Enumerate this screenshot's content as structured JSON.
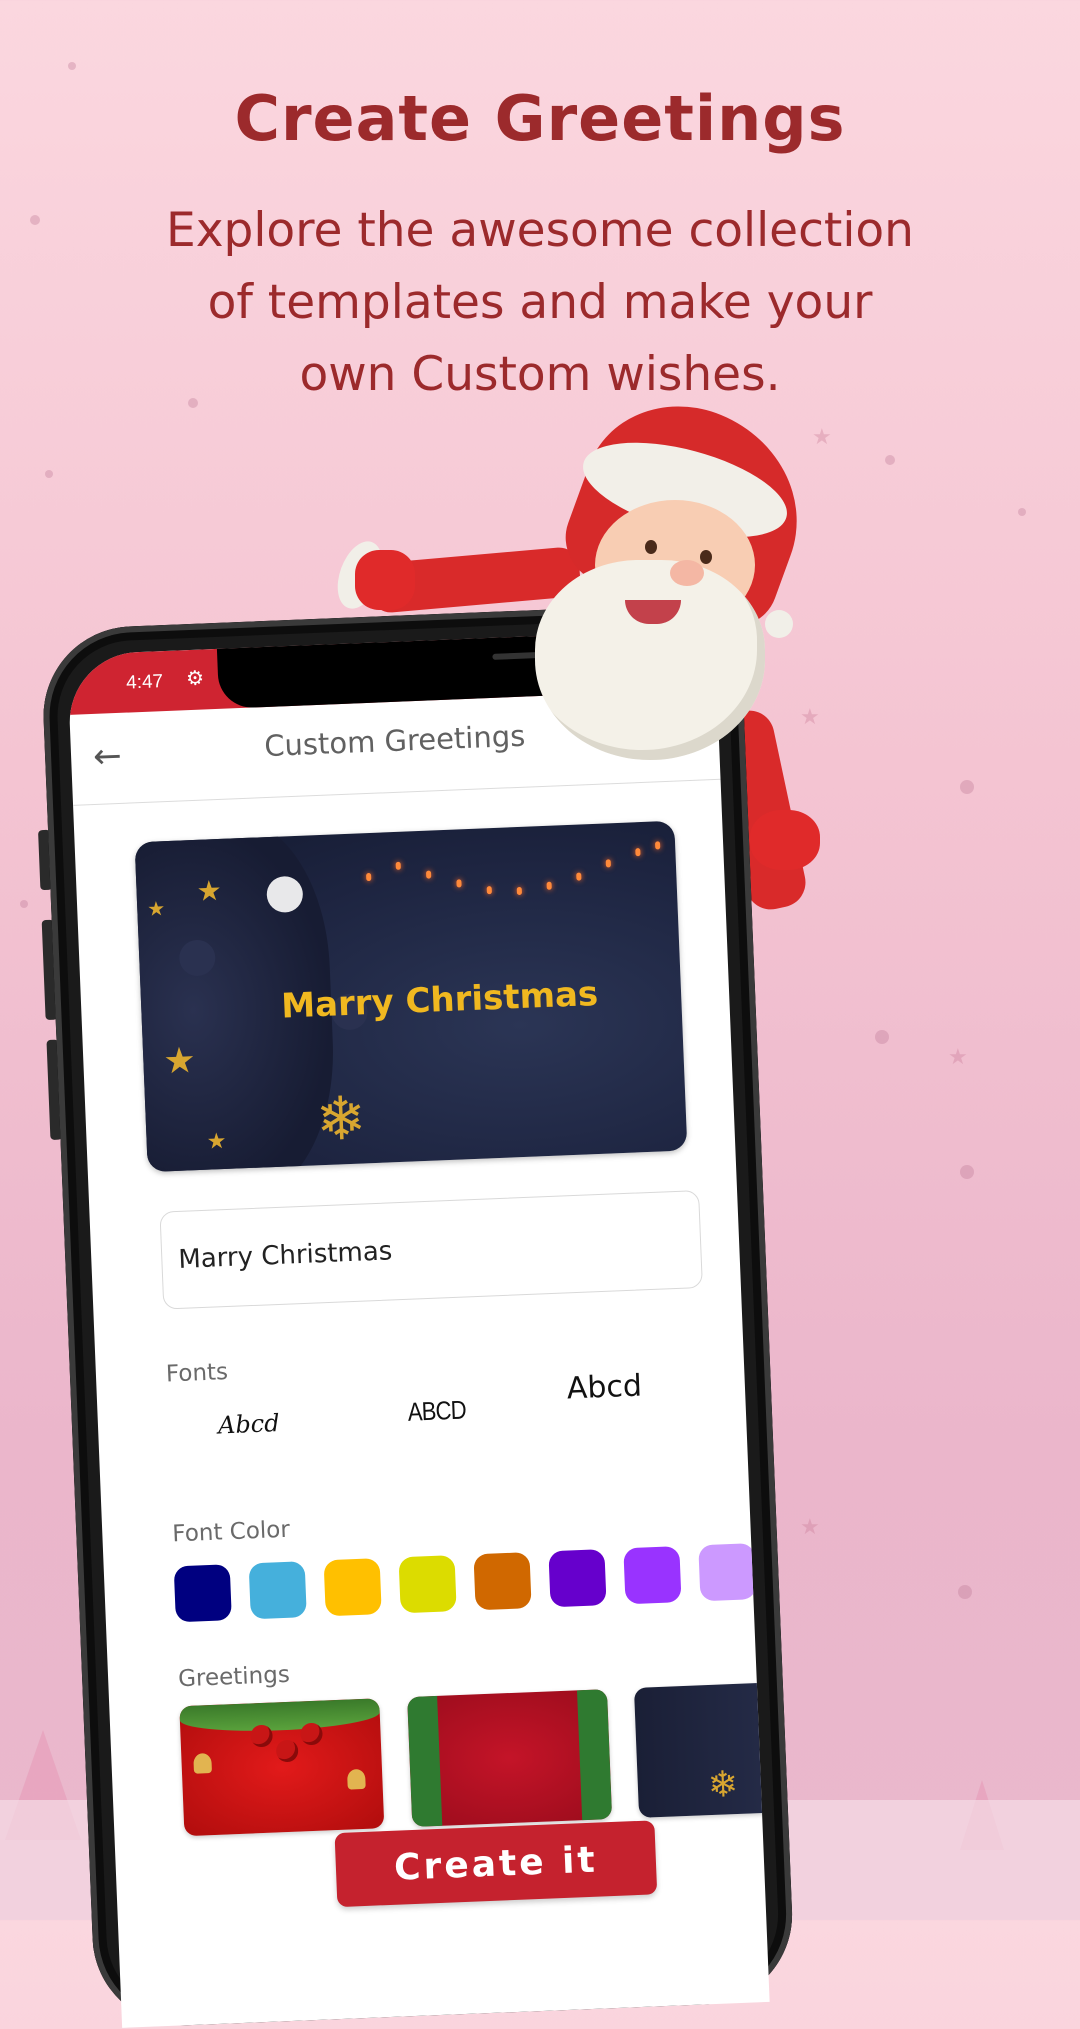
{
  "promo": {
    "headline": "Create Greetings",
    "subline_lines": [
      "Explore the awesome collection",
      "of templates and make your",
      "own Custom wishes."
    ]
  },
  "status_bar": {
    "time": "4:47",
    "icon": "settings-gear-icon"
  },
  "app_bar": {
    "back_icon": "arrow-left-icon",
    "title": "Custom Greetings"
  },
  "preview": {
    "text": "Marry Christmas",
    "text_color": "#F0B820",
    "background": "dark-navy-christmas-tree"
  },
  "greeting_input": {
    "value": "Marry Christmas",
    "placeholder": ""
  },
  "fonts": {
    "label": "Fonts",
    "samples": [
      "Abcd",
      "ABCD",
      "Abcd"
    ]
  },
  "font_color": {
    "label": "Font Color",
    "swatches": [
      "#000080",
      "#45B0DC",
      "#FFC000",
      "#DCDC00",
      "#D06800",
      "#6600CC",
      "#9933FF",
      "#CC99FF"
    ]
  },
  "greetings": {
    "label": "Greetings",
    "templates": [
      {
        "name": "red-baubles"
      },
      {
        "name": "crimson-garland"
      },
      {
        "name": "navy-tree"
      }
    ]
  },
  "actions": {
    "create_label": "Create it"
  },
  "colors": {
    "brand_red": "#C5222E",
    "headline": "#9C2A2C",
    "background": "#F4C4D2"
  }
}
